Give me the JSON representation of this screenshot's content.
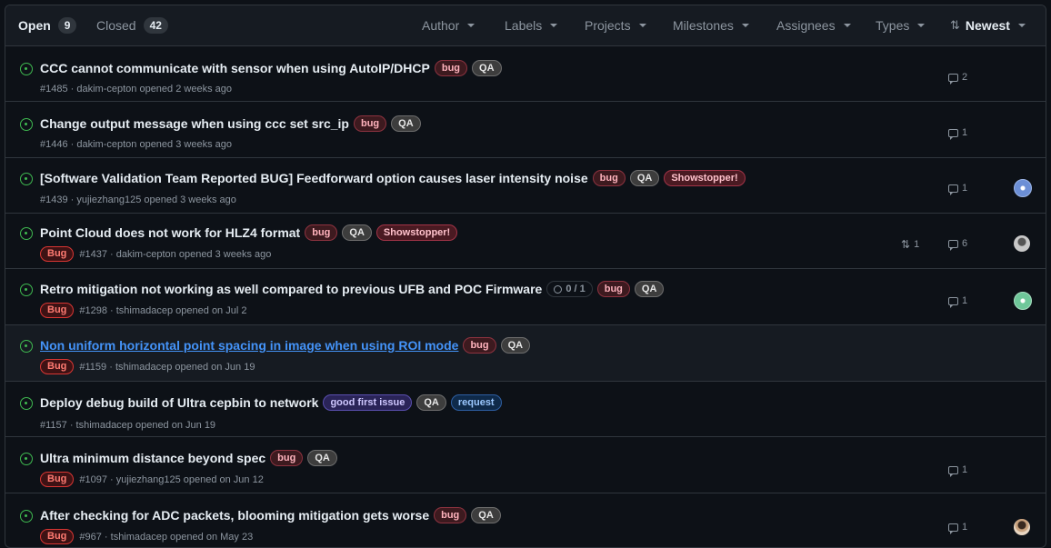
{
  "header": {
    "open_label": "Open",
    "open_count": "9",
    "closed_label": "Closed",
    "closed_count": "42",
    "filters": [
      "Author",
      "Labels",
      "Projects",
      "Milestones",
      "Assignees",
      "Types"
    ],
    "sort_label": "Newest"
  },
  "issues": [
    {
      "title": "CCC cannot communicate with sensor when using AutoIP/DHCP",
      "labels": [
        "bug",
        "QA"
      ],
      "meta": "#1485 · dakim-cepton opened 2 weeks ago",
      "type": "",
      "comments": "2"
    },
    {
      "title": "Change output message when using ccc set src_ip",
      "labels": [
        "bug",
        "QA"
      ],
      "meta": "#1446 · dakim-cepton opened 3 weeks ago",
      "type": "",
      "comments": "1"
    },
    {
      "title": "[Software Validation Team Reported BUG] Feedforward option causes laser intensity noise",
      "labels": [
        "bug",
        "QA",
        "Showstopper!"
      ],
      "meta": "#1439 · yujiezhang125 opened 3 weeks ago",
      "type": "",
      "comments": "1",
      "avatar": "blue-identicon"
    },
    {
      "title": "Point Cloud does not work for HLZ4 format",
      "labels": [
        "bug",
        "QA",
        "Showstopper!"
      ],
      "meta": "#1437 · dakim-cepton opened 3 weeks ago",
      "type": "Bug",
      "prs": "1",
      "comments": "6",
      "avatar": "gray-photo"
    },
    {
      "title": "Retro mitigation not working as well compared to previous UFB and POC Firmware",
      "progress": "0 / 1",
      "labels": [
        "bug",
        "QA"
      ],
      "meta": "#1298 · tshimadacep opened on Jul 2",
      "type": "Bug",
      "comments": "1",
      "avatar": "green-identicon"
    },
    {
      "title": "Non uniform horizontal point spacing in image when using ROI mode",
      "labels": [
        "bug",
        "QA"
      ],
      "meta": "#1159 · tshimadacep opened on Jun 19",
      "type": "Bug",
      "comments": ""
    },
    {
      "title": "Deploy debug build of Ultra cepbin to network",
      "labels": [
        "good first issue",
        "QA",
        "request"
      ],
      "meta": "#1157 · tshimadacep opened on Jun 19",
      "type": "",
      "comments": ""
    },
    {
      "title": "Ultra minimum distance beyond spec",
      "labels": [
        "bug",
        "QA"
      ],
      "meta": "#1097 · yujiezhang125 opened on Jun 12",
      "type": "Bug",
      "comments": "1"
    },
    {
      "title": "After checking for ADC packets, blooming mitigation gets worse",
      "labels": [
        "bug",
        "QA"
      ],
      "meta": "#967 · tshimadacep opened on May 23",
      "type": "Bug",
      "comments": "1",
      "avatar": "person-photo"
    }
  ],
  "colors": {
    "open_icon": "#3fb950",
    "link_hover": "#4493f8",
    "bug_type": "#da3633"
  }
}
